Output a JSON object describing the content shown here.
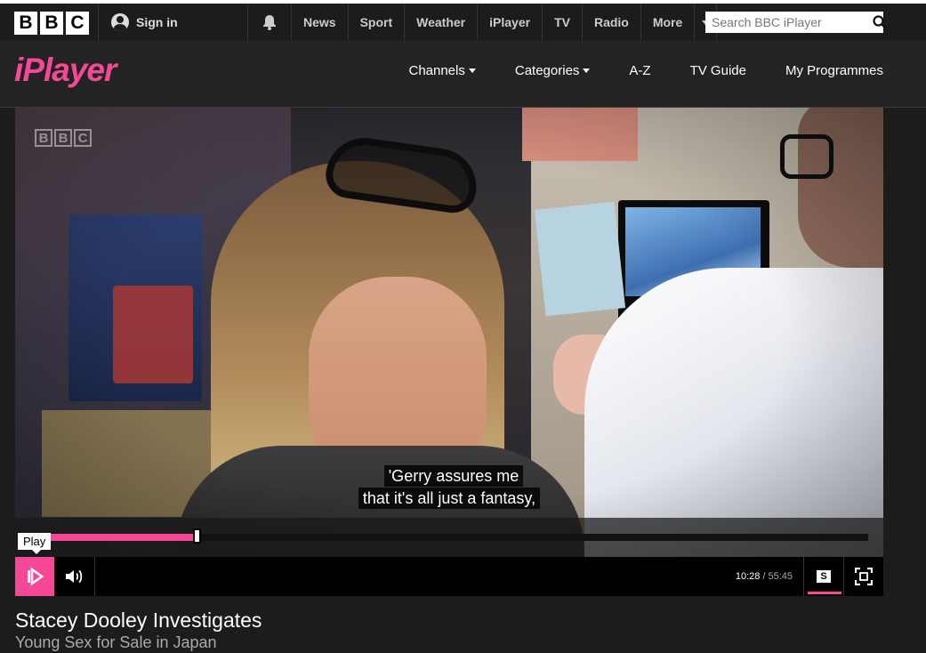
{
  "global_nav": {
    "logo_letters": [
      "B",
      "B",
      "C"
    ],
    "sign_in": "Sign in",
    "links": [
      "News",
      "Sport",
      "Weather",
      "iPlayer",
      "TV",
      "Radio",
      "More"
    ],
    "search_placeholder": "Search BBC iPlayer"
  },
  "iplayer_header": {
    "logo": "iPlayer",
    "nav": [
      {
        "label": "Channels",
        "dropdown": true
      },
      {
        "label": "Categories",
        "dropdown": true
      },
      {
        "label": "A-Z",
        "dropdown": false
      },
      {
        "label": "TV Guide",
        "dropdown": false
      },
      {
        "label": "My Programmes",
        "dropdown": false
      }
    ]
  },
  "player": {
    "channel_logo": [
      "B",
      "B",
      "C"
    ],
    "subtitle_lines": [
      "'Gerry assures me",
      "that it's all just a fantasy,"
    ],
    "tooltip": "Play",
    "current_time": "10:28",
    "total_time": "/ 55:45",
    "progress_fraction": 0.18,
    "subtitles_label": "S",
    "accent_color": "#f54997"
  },
  "programme": {
    "title": "Stacey Dooley Investigates",
    "episode": "Young Sex for Sale in Japan"
  }
}
